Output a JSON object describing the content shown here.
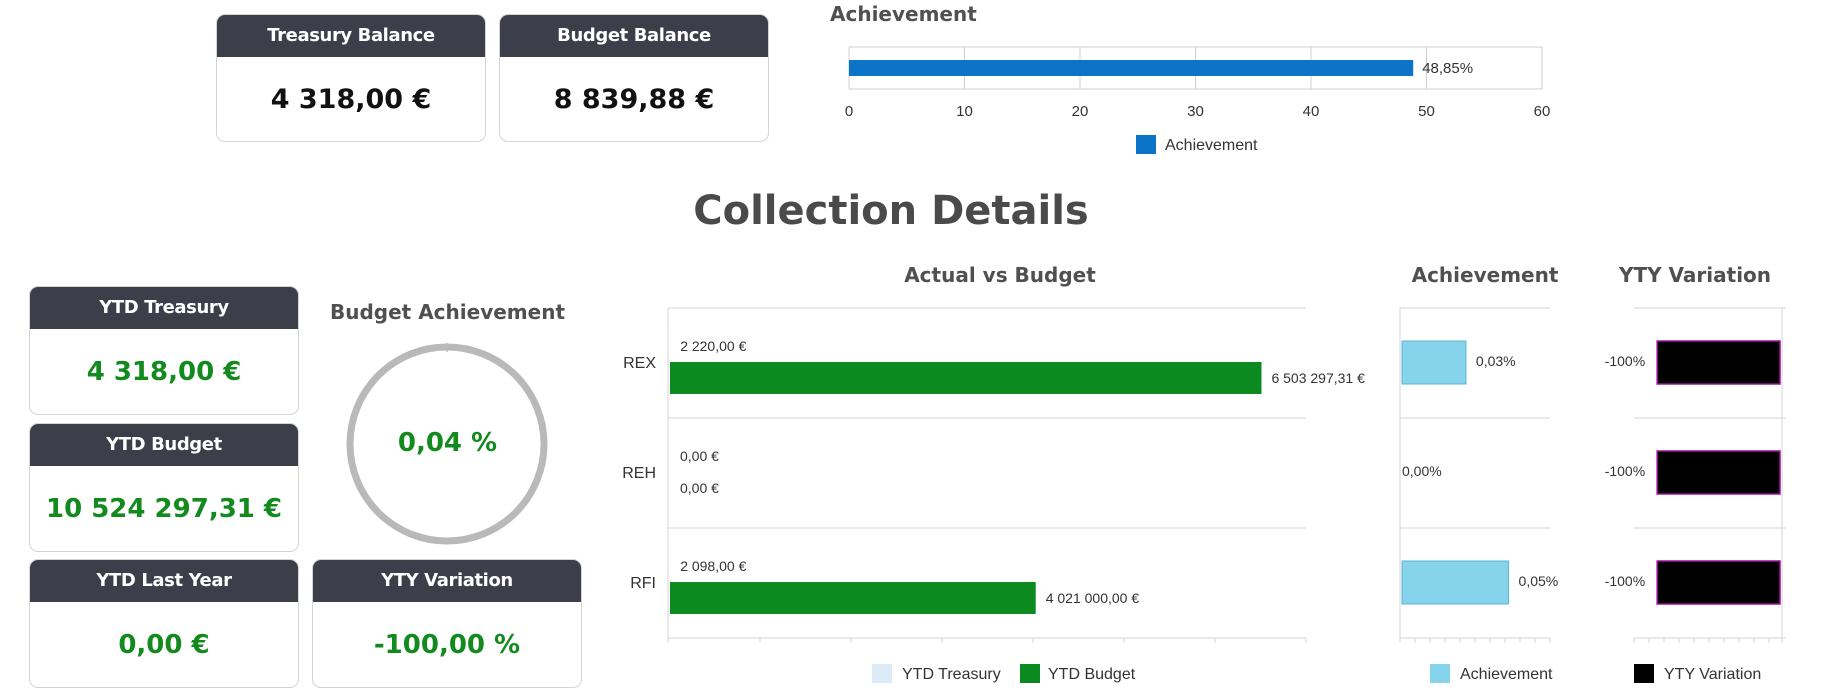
{
  "top_cards": {
    "treasury_balance": {
      "title": "Treasury Balance",
      "value": "4 318,00 €"
    },
    "budget_balance": {
      "title": "Budget Balance",
      "value": "8 839,88 €"
    }
  },
  "top_achievement": {
    "title": "Achievement",
    "legend": "Achievement",
    "bar_label": "48,85%",
    "color": "#0b73c8"
  },
  "section_title": "Collection Details",
  "ytd_cards": {
    "ytd_treasury": {
      "title": "YTD Treasury",
      "value": "4 318,00 €"
    },
    "ytd_budget": {
      "title": "YTD Budget",
      "value": "10 524 297,31 €"
    },
    "ytd_last_year": {
      "title": "YTD Last Year",
      "value": "0,00 €"
    },
    "yty_variation": {
      "title": "YTY Variation",
      "value": "-100,00 %"
    }
  },
  "budget_achievement": {
    "title": "Budget Achievement",
    "value": "0,04 %",
    "percent": 0.04
  },
  "actual_vs_budget": {
    "title": "Actual vs Budget",
    "legend": [
      "YTD Treasury",
      "YTD Budget"
    ]
  },
  "achievement_chart": {
    "title": "Achievement",
    "legend": "Achievement"
  },
  "yty_chart": {
    "title": "YTY Variation",
    "legend": "YTY Variation"
  },
  "colors": {
    "header_dark": "#3c3f4a",
    "green_value": "#138a1e",
    "budget_bar": "#0b8a1f",
    "treasury_bar": "#dce9f7",
    "achievement_bar": "#86d3ec",
    "yty_bar": "#000000",
    "yty_border": "#a0119e",
    "top_bar": "#0b73c8"
  },
  "chart_data": [
    {
      "type": "bar",
      "orientation": "horizontal",
      "title": "Achievement",
      "series": [
        {
          "name": "Achievement",
          "values": [
            48.85
          ]
        }
      ],
      "data_labels": [
        "48,85%"
      ],
      "xlim": [
        0,
        60
      ],
      "xticks": [
        0,
        10,
        20,
        30,
        40,
        50,
        60
      ],
      "grid": true,
      "legend": "bottom"
    },
    {
      "type": "bar",
      "orientation": "horizontal",
      "title": "Actual vs Budget",
      "categories": [
        "REX",
        "REH",
        "RFI"
      ],
      "series": [
        {
          "name": "YTD Treasury",
          "values": [
            2220.0,
            0.0,
            2098.0
          ],
          "labels": [
            "2 220,00 €",
            "0,00 €",
            "2 098,00 €"
          ]
        },
        {
          "name": "YTD Budget",
          "values": [
            6503297.31,
            0.0,
            4021000.0
          ],
          "labels": [
            "6 503 297,31 €",
            "0,00 €",
            "4 021 000,00 €"
          ]
        }
      ],
      "legend": "bottom"
    },
    {
      "type": "bar",
      "orientation": "horizontal",
      "title": "Achievement",
      "categories": [
        "REX",
        "REH",
        "RFI"
      ],
      "series": [
        {
          "name": "Achievement",
          "values": [
            0.03,
            0.0,
            0.05
          ],
          "labels": [
            "0,03%",
            "0,00%",
            "0,05%"
          ]
        }
      ],
      "legend": "bottom"
    },
    {
      "type": "bar",
      "orientation": "horizontal",
      "title": "YTY Variation",
      "categories": [
        "REX",
        "REH",
        "RFI"
      ],
      "series": [
        {
          "name": "YTY Variation",
          "values": [
            -100,
            -100,
            -100
          ],
          "labels": [
            "-100%",
            "-100%",
            "-100%"
          ]
        }
      ],
      "legend": "bottom"
    }
  ]
}
